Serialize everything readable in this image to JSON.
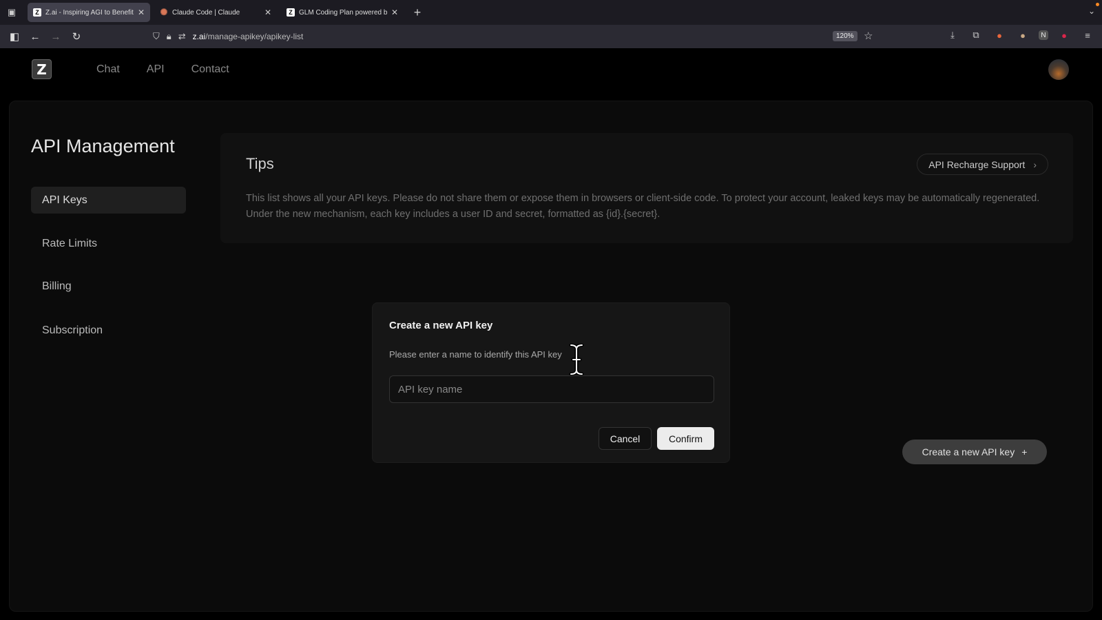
{
  "browser": {
    "tabs": [
      {
        "title": "Z.ai - Inspiring AGI to Benefit Hu",
        "icon": "z-favicon",
        "active": true
      },
      {
        "title": "Claude Code | Claude",
        "icon": "claude-favicon",
        "active": false
      },
      {
        "title": "GLM Coding Plan powered by G",
        "icon": "z-favicon",
        "active": false
      }
    ],
    "url_host": "z.ai",
    "url_path": "/manage-apikey/apikey-list",
    "zoom": "120%"
  },
  "site": {
    "logo_letter": "Z",
    "nav": [
      "Chat",
      "API",
      "Contact"
    ]
  },
  "sidebar": {
    "title": "API Management",
    "items": [
      {
        "label": "API Keys",
        "active": true
      },
      {
        "label": "Rate Limits",
        "active": false
      },
      {
        "label": "Billing",
        "active": false
      },
      {
        "label": "Subscription",
        "active": false
      }
    ]
  },
  "tips": {
    "title": "Tips",
    "recharge_label": "API Recharge Support",
    "text": "This list shows all your API keys. Please do not share them or expose them in browsers or client-side code. To protect your account, leaked keys may be automatically regenerated. Under the new mechanism, each key includes a user ID and secret, formatted as {id}.{secret}."
  },
  "create_button_label": "Create a new API key",
  "modal": {
    "title": "Create a new API key",
    "description": "Please enter a name to identify this API key",
    "input_placeholder": "API key name",
    "input_value": "",
    "cancel_label": "Cancel",
    "confirm_label": "Confirm"
  },
  "colors": {
    "background": "#000000",
    "card": "#0b0b0b",
    "modal": "#161616",
    "confirm_button": "#ececec",
    "create_button": "#3d3d3d"
  }
}
